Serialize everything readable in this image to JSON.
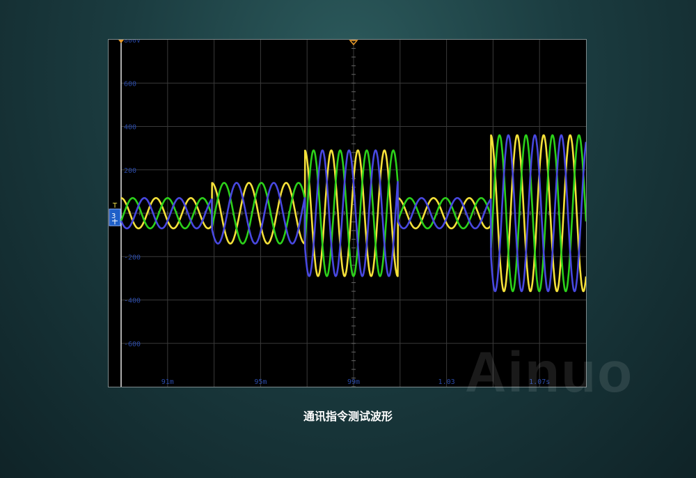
{
  "chart_data": {
    "type": "line",
    "y_axis_top_label": "800V",
    "y_ticks": [
      {
        "value": 800,
        "label": "800V"
      },
      {
        "value": 600,
        "label": "600"
      },
      {
        "value": 400,
        "label": "400"
      },
      {
        "value": 200,
        "label": "200"
      },
      {
        "value": -200,
        "label": "-200"
      },
      {
        "value": -400,
        "label": "-400"
      },
      {
        "value": -600,
        "label": "-600"
      }
    ],
    "ylim": [
      -800,
      800
    ],
    "x_tick_labels": [
      "91m",
      "95m",
      "99m",
      "1.03",
      "1.07s"
    ],
    "channel_marker": "3",
    "trigger_marker": "T",
    "segments": [
      {
        "start": 0.0,
        "end": 0.195,
        "amplitude": 70,
        "cycles": 2.6
      },
      {
        "start": 0.195,
        "end": 0.395,
        "amplitude": 140,
        "cycles": 2.5
      },
      {
        "start": 0.395,
        "end": 0.595,
        "amplitude": 290,
        "cycles": 3.5
      },
      {
        "start": 0.595,
        "end": 0.795,
        "amplitude": 70,
        "cycles": 2.6
      },
      {
        "start": 0.795,
        "end": 1.0,
        "amplitude": 360,
        "cycles": 3.6
      }
    ],
    "series": [
      {
        "color": "#f5e13a",
        "phase_deg": 90
      },
      {
        "color": "#2cd11a",
        "phase_deg": -30
      },
      {
        "color": "#4848e0",
        "phase_deg": 210
      }
    ],
    "grid": true
  },
  "watermark": "Ainuo",
  "caption": "通讯指令测试波形"
}
